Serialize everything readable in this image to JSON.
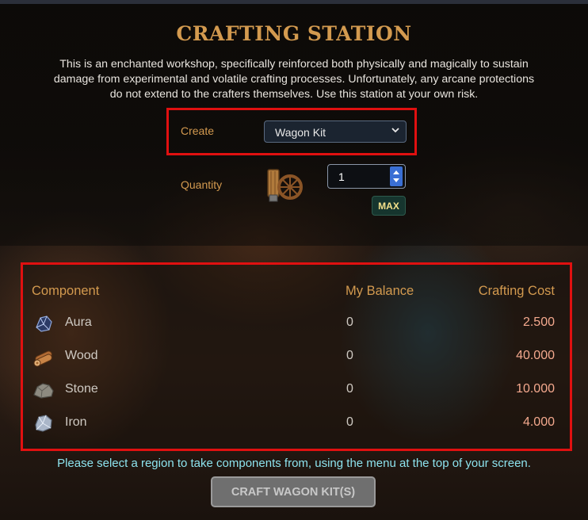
{
  "title": "CRAFTING STATION",
  "description": "This is an enchanted workshop, specifically reinforced both physically and magically to sustain damage from experimental and volatile crafting processes. Unfortunately, any arcane protections do not extend to the crafters themselves. Use this station at your own risk.",
  "create": {
    "label": "Create",
    "selected": "Wagon Kit",
    "icon": "chevron-down-icon"
  },
  "quantity": {
    "label": "Quantity",
    "value": "1",
    "item_icon": "wagon-kit-icon",
    "max_label": "MAX"
  },
  "table": {
    "headers": {
      "component": "Component",
      "balance": "My Balance",
      "cost": "Crafting Cost"
    },
    "rows": [
      {
        "icon": "aura-icon",
        "name": "Aura",
        "balance": "0",
        "cost": "2.500"
      },
      {
        "icon": "wood-icon",
        "name": "Wood",
        "balance": "0",
        "cost": "40.000"
      },
      {
        "icon": "stone-icon",
        "name": "Stone",
        "balance": "0",
        "cost": "10.000"
      },
      {
        "icon": "iron-icon",
        "name": "Iron",
        "balance": "0",
        "cost": "4.000"
      }
    ]
  },
  "notice": "Please select a region to take components from, using the menu at the top of your screen.",
  "craft_button": "CRAFT WAGON KIT(S)",
  "colors": {
    "accent_orange": "#d39a4f",
    "cost_text": "#f4a98e",
    "notice_text": "#8de3ee",
    "highlight_red": "#e01010",
    "max_text": "#f3e08a"
  }
}
